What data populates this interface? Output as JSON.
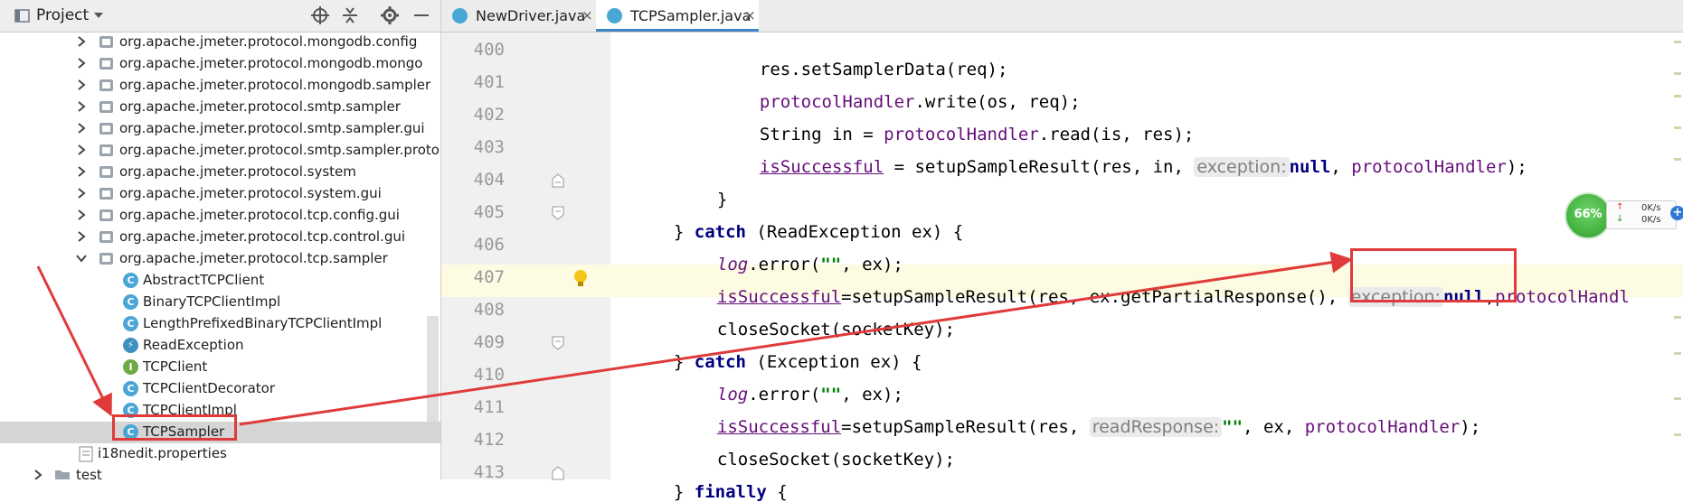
{
  "project_panel": {
    "title": "Project",
    "icons": {
      "dropdown": "chevron-down-icon",
      "locate": "crosshair-icon",
      "collapse": "collapse-all-icon",
      "settings": "gear-icon",
      "hide": "minimize-icon"
    },
    "tree": [
      {
        "label": "org.apache.jmeter.protocol.mongodb.config",
        "kind": "package",
        "expanded": false
      },
      {
        "label": "org.apache.jmeter.protocol.mongodb.mongo",
        "kind": "package",
        "expanded": false
      },
      {
        "label": "org.apache.jmeter.protocol.mongodb.sampler",
        "kind": "package",
        "expanded": false
      },
      {
        "label": "org.apache.jmeter.protocol.smtp.sampler",
        "kind": "package",
        "expanded": false
      },
      {
        "label": "org.apache.jmeter.protocol.smtp.sampler.gui",
        "kind": "package",
        "expanded": false
      },
      {
        "label": "org.apache.jmeter.protocol.smtp.sampler.proto",
        "kind": "package",
        "expanded": false
      },
      {
        "label": "org.apache.jmeter.protocol.system",
        "kind": "package",
        "expanded": false
      },
      {
        "label": "org.apache.jmeter.protocol.system.gui",
        "kind": "package",
        "expanded": false
      },
      {
        "label": "org.apache.jmeter.protocol.tcp.config.gui",
        "kind": "package",
        "expanded": false
      },
      {
        "label": "org.apache.jmeter.protocol.tcp.control.gui",
        "kind": "package",
        "expanded": false
      },
      {
        "label": "org.apache.jmeter.protocol.tcp.sampler",
        "kind": "package",
        "expanded": true
      },
      {
        "label": "AbstractTCPClient",
        "kind": "class",
        "letter": "C"
      },
      {
        "label": "BinaryTCPClientImpl",
        "kind": "class",
        "letter": "C"
      },
      {
        "label": "LengthPrefixedBinaryTCPClientImpl",
        "kind": "class",
        "letter": "C"
      },
      {
        "label": "ReadException",
        "kind": "exception",
        "letter": "⚡"
      },
      {
        "label": "TCPClient",
        "kind": "interface",
        "letter": "I"
      },
      {
        "label": "TCPClientDecorator",
        "kind": "class",
        "letter": "C"
      },
      {
        "label": "TCPClientImpl",
        "kind": "class",
        "letter": "C"
      },
      {
        "label": "TCPSampler",
        "kind": "class",
        "letter": "C",
        "selected": true
      },
      {
        "label": "i18nedit.properties",
        "kind": "file"
      },
      {
        "label": "test",
        "kind": "folder"
      }
    ]
  },
  "editor": {
    "tabs": [
      {
        "label": "NewDriver.java",
        "active": false,
        "close": "×"
      },
      {
        "label": "TCPSampler.java",
        "active": true,
        "close": "×"
      }
    ],
    "line_numbers": [
      "400",
      "401",
      "402",
      "403",
      "404",
      "405",
      "406",
      "407",
      "408",
      "409",
      "410",
      "411",
      "412",
      "413"
    ],
    "code": {
      "l400": {
        "a": "res.setSamplerData(req);"
      },
      "l401": {
        "f": "protocolHandler",
        "a": ".write(os, req);"
      },
      "l402": {
        "a": "String in = ",
        "f": "protocolHandler",
        "b": ".read(is, res);"
      },
      "l403": {
        "f": "isSuccessful",
        "a": " = setupSampleResult(res, in, ",
        "hint": "exception:",
        "kw": "null",
        "b": ", ",
        "f2": "protocolHandler",
        "c": ");"
      },
      "l404": {
        "a": "}"
      },
      "l405": {
        "a": "} ",
        "kw": "catch",
        "b": " (ReadException ex) {"
      },
      "l406": {
        "f": "log",
        "a": ".error(",
        "s": "\"\"",
        "b": ", ex);"
      },
      "l407": {
        "f": "isSuccessful",
        "a": "=setupSampleResult(res, ex.getPartialResponse(), ",
        "hint": "exception:",
        "kw": "null",
        "b": ",",
        "f2": "protocolHandl"
      },
      "l408": {
        "a": "closeSocket(socketKey);"
      },
      "l409": {
        "a": "} ",
        "kw": "catch",
        "b": " (Exception ex) {"
      },
      "l410": {
        "f": "log",
        "a": ".error(",
        "s": "\"\"",
        "b": ", ex);"
      },
      "l411": {
        "f": "isSuccessful",
        "a": "=setupSampleResult(res, ",
        "hint": "readResponse:",
        "s": "\"\"",
        "b": ", ex, ",
        "f2": "protocolHandler",
        "c": ");"
      },
      "l412": {
        "a": "closeSocket(socketKey);"
      },
      "l413": {
        "a": "} ",
        "kw": "finally",
        "b": " {"
      }
    }
  },
  "net_widget": {
    "percent": "66%",
    "up": "0K/s",
    "down": "0K/s",
    "plus": "+"
  },
  "colors": {
    "annotation": "#e03a3a",
    "keyword": "#00007f",
    "field": "#660e7a",
    "string": "#008000",
    "selection": "#d5d5d5"
  }
}
